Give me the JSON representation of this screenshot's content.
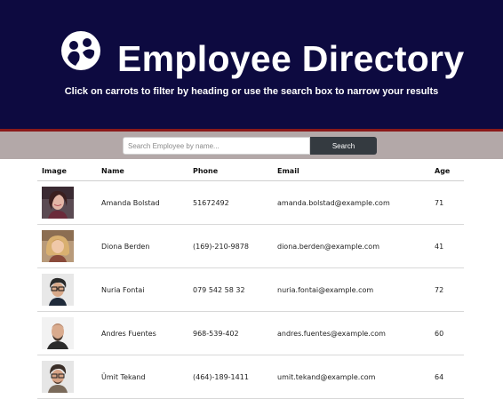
{
  "header": {
    "title": "Employee Directory",
    "subtitle": "Click on carrots to filter by heading or use the search box to narrow your results"
  },
  "search": {
    "placeholder": "Search Employee by name...",
    "value": "",
    "button_label": "Search"
  },
  "table": {
    "columns": [
      "Image",
      "Name",
      "Phone",
      "Email",
      "Age"
    ],
    "rows": [
      {
        "name": "Amanda Bolstad",
        "phone": "51672492",
        "email": "amanda.bolstad@example.com",
        "age": "71",
        "avatar": "avatar-woman-dark-hair"
      },
      {
        "name": "Diona Berden",
        "phone": "(169)-210-9878",
        "email": "diona.berden@example.com",
        "age": "41",
        "avatar": "avatar-woman-blonde"
      },
      {
        "name": "Nuria Fontai",
        "phone": "079 542 58 32",
        "email": "nuria.fontai@example.com",
        "age": "72",
        "avatar": "avatar-woman-glasses"
      },
      {
        "name": "Andres Fuentes",
        "phone": "968-539-402",
        "email": "andres.fuentes@example.com",
        "age": "60",
        "avatar": "avatar-man-bald"
      },
      {
        "name": "Ümit Tekand",
        "phone": "(464)-189-1411",
        "email": "umit.tekand@example.com",
        "age": "64",
        "avatar": "avatar-man-glasses"
      }
    ]
  },
  "colors": {
    "header_bg": "#0d0a40",
    "header_border": "#8b1a1a",
    "search_strip_bg": "#b3a8a8",
    "search_button_bg": "#343a40"
  }
}
